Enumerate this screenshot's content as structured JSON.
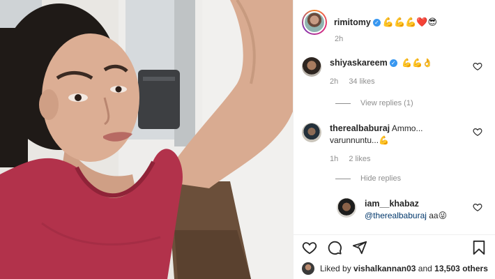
{
  "post": {
    "owner": {
      "username": "rimitomy",
      "caption_emojis": "💪💪💪❤️😎",
      "time": "2h"
    }
  },
  "comments": [
    {
      "username": "shiyaskareem",
      "text": "💪💪👌",
      "time": "2h",
      "likes": "34 likes",
      "replies_label": "View replies (1)"
    },
    {
      "username": "therealbaburaj",
      "text": "Ammo... varunnuntu...💪",
      "time": "1h",
      "likes": "2 likes",
      "replies_label": "Hide replies",
      "reply": {
        "username": "iam__khabaz",
        "mention": "@therealbaburaj",
        "text": " aa😜"
      }
    }
  ],
  "footer": {
    "liked_by_prefix": "Liked by ",
    "liked_by_user": "vishalkannan03",
    "liked_by_mid": " and ",
    "liked_by_count": "13,503 others"
  },
  "colors": {
    "shirt": "#b2324b",
    "link": "#00376b",
    "verified": "#3897f0",
    "muted": "#8e8e8e"
  },
  "icons": [
    "heart-icon",
    "comment-icon",
    "share-icon",
    "bookmark-icon",
    "verified-badge"
  ]
}
